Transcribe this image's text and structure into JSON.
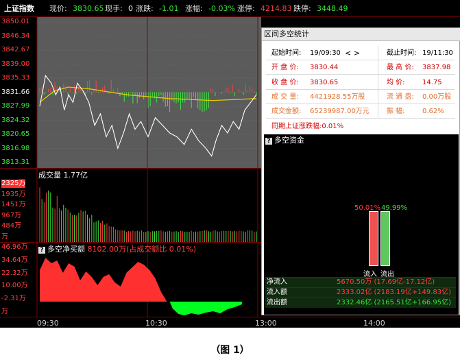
{
  "header": {
    "title": "上证指数",
    "price_label": "现价:",
    "price": "3830.65",
    "vol_label": "现手:",
    "vol": "0",
    "chg_label": "涨跌:",
    "chg": "-1.01",
    "pct_label": "涨幅:",
    "pct": "-0.03%",
    "limit_up_label": "涨停:",
    "limit_up": "4214.83",
    "limit_down_label": "跌停:",
    "limit_down": "3448.49"
  },
  "price_axis": [
    "3850.01",
    "3846.34",
    "3842.67",
    "3839.00",
    "3835.33",
    "3831.66",
    "3827.99",
    "3824.32",
    "3820.65",
    "3816.98",
    "3813.31"
  ],
  "volume_panel": {
    "label": "成交量 1.77亿",
    "axis": [
      "2325万",
      "1935万",
      "1451万",
      "967万",
      "484万",
      "万"
    ]
  },
  "flow_panel": {
    "label": "多空净买额",
    "value": "8102.00万(占成交额比 0.01%)",
    "axis": [
      "46.96万",
      "34.64万",
      "22.32万",
      "10.00万",
      "-2.31万",
      "万"
    ]
  },
  "time_axis": [
    "09:30",
    "10:30",
    "13:00",
    "14:00"
  ],
  "dialog": {
    "title": "区间多空统计",
    "start_label": "起始时间:",
    "start_value": "19/09:30",
    "prev_arrow": "<",
    "next_arrow": ">",
    "end_label": "截止时间:",
    "end_value": "19/11:30",
    "open_label": "开 盘 价:",
    "open_value": "3830.44",
    "high_label": "最 高 价:",
    "high_value": "3837.98",
    "close_label": "收 盘 价:",
    "close_value": "3830.65",
    "avg_label": "均    价:",
    "avg_value": "14.75",
    "volume_label": "成 交 量:",
    "volume_value": "4421928.55万股",
    "float_label": "流 通 盘:",
    "float_value": "0.00万股",
    "amount_label": "成交金额:",
    "amount_value": "65239987.00万元",
    "swing_label": "振    幅:",
    "swing_value": "0.62%",
    "index_change": "同期上证涨跌幅:0.01%",
    "sub_title": "多空资金",
    "inflow_pct": "50.01%",
    "outflow_pct": "49.99%",
    "inflow_pct_value": 50.01,
    "outflow_pct_value": 49.99,
    "inflow_label": "流入",
    "outflow_label": "流出",
    "net_label": "净流入",
    "net_value": "5670.50万 (17.69亿-17.12亿)",
    "in_label": "流入额",
    "in_value": "2333.02亿 (2183.19亿+149.83亿)",
    "out_label": "流出额",
    "out_value": "2332.46亿 (2165.51亿+166.95亿)"
  },
  "caption": "（图 1）",
  "colors": {
    "up": "#ff4040",
    "down": "#3ce63c",
    "price_line": "#ffffff",
    "avg_line": "#e8c800",
    "panel_bg": "#5b5b5b",
    "frame": "#7a0000"
  }
}
